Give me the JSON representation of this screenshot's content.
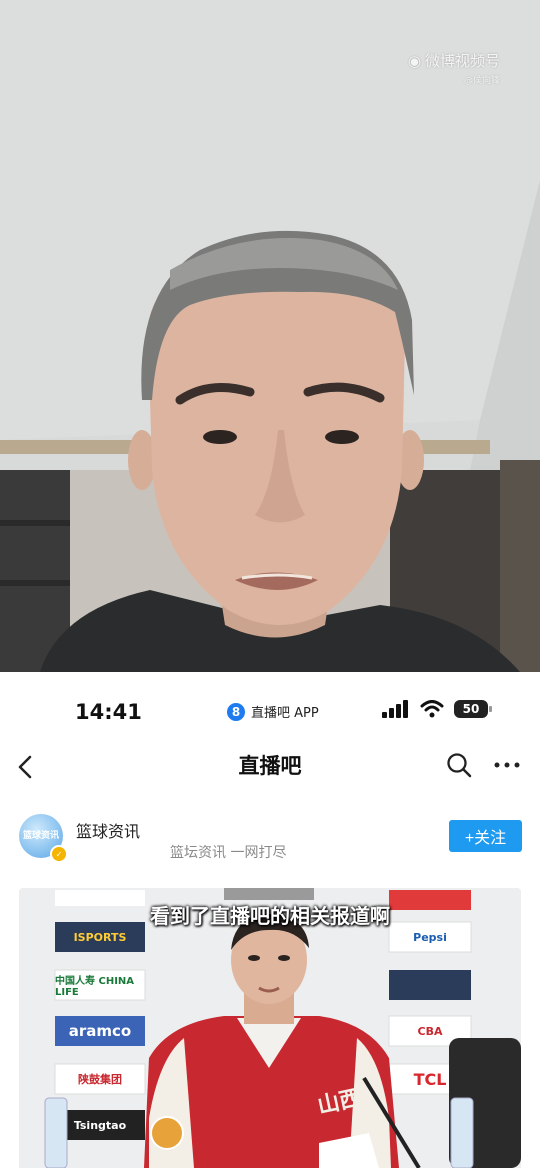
{
  "video": {
    "watermark_main": "微博视频号",
    "watermark_sub": "@侯向锋"
  },
  "status_bar": {
    "time": "14:41",
    "app_badge": "8",
    "app_name": "直播吧 APP",
    "battery": "50"
  },
  "nav": {
    "title": "直播吧"
  },
  "account": {
    "name": "篮球资讯",
    "description": "篮坛资讯 一网打尽",
    "avatar_text": "篮球资讯",
    "follow_label": "+关注"
  },
  "card": {
    "caption": "看到了直播吧的相关报道啊",
    "sponsors": [
      "ISPORTS",
      "中国人寿 CHINA LIFE",
      "aramco",
      "陕鼓集团",
      "Tsingtao",
      "Pepsi",
      "CBA",
      "TCL"
    ],
    "jersey_text": "山西"
  },
  "colors": {
    "accent": "#1e9bf0",
    "app_badge": "#1e7cf0"
  }
}
